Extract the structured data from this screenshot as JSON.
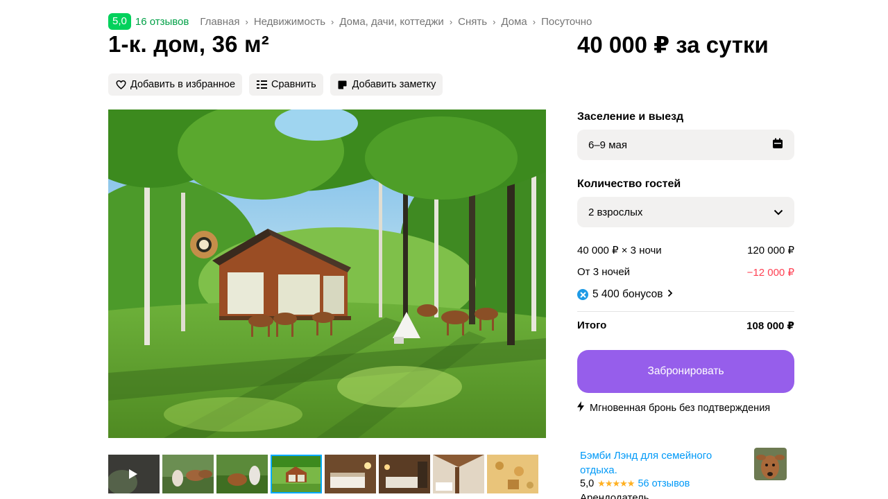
{
  "header": {
    "rating": "5,0",
    "reviews": "16 отзывов",
    "breadcrumbs": [
      "Главная",
      "Недвижимость",
      "Дома, дачи, коттеджи",
      "Снять",
      "Дома",
      "Посуточно"
    ]
  },
  "listing": {
    "title": "1-к. дом, 36 м²",
    "price": "40 000 ₽ за сутки"
  },
  "actions": {
    "favorite": "Добавить в избранное",
    "compare": "Сравнить",
    "note": "Добавить заметку"
  },
  "gallery": {
    "thumbnail_count": 8,
    "active_thumbnail": 4
  },
  "booking": {
    "dates_label": "Заселение и выезд",
    "dates_value": "6–9 мая",
    "guests_label": "Количество гостей",
    "guests_value": "2 взрослых",
    "nights_label": "40 000 ₽ × 3 ночи",
    "nights_value": "120 000 ₽",
    "discount_label": "От 3 ночей",
    "discount_value": "−12 000 ₽",
    "bonus": "5 400 бонусов",
    "total_label": "Итого",
    "total_value": "108 000 ₽",
    "book_button": "Забронировать",
    "instant_note": "Мгновенная бронь без подтверждения"
  },
  "seller": {
    "name": "Бэмби Лэнд для семейного отдыха.",
    "rating": "5,0",
    "reviews": "56 отзывов",
    "type": "Арендодатель"
  },
  "colors": {
    "rating_green": "#02d15c",
    "link_blue": "#0099f7",
    "book_purple": "#965eeb",
    "discount_red": "#ff4053"
  }
}
